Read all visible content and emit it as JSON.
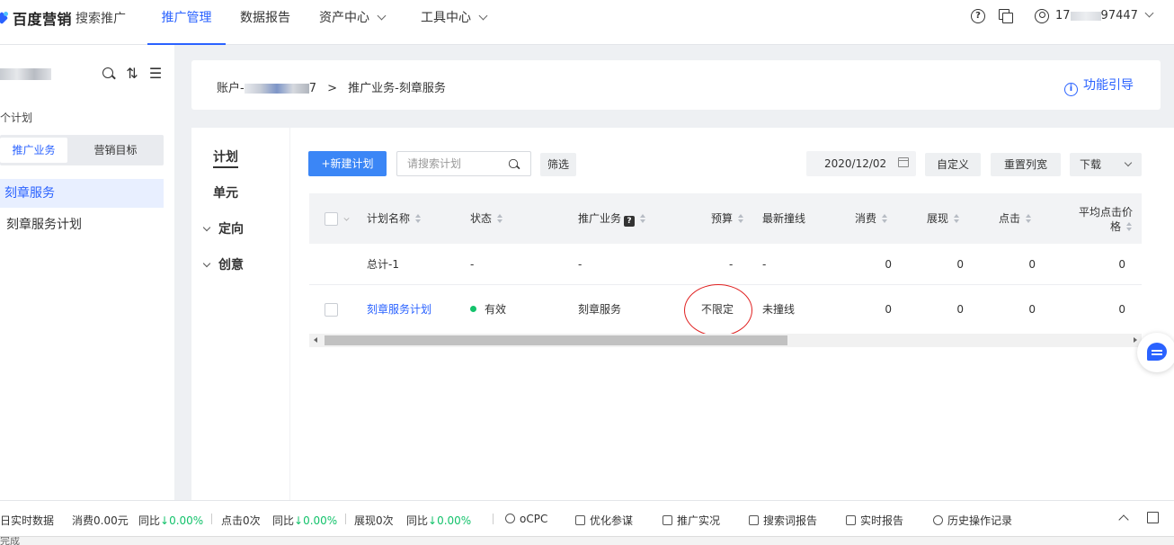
{
  "brand": {
    "name": "百度营销",
    "sub": "搜索推广"
  },
  "nav": [
    {
      "label": "推广管理",
      "active": true
    },
    {
      "label": "数据报告",
      "active": false
    },
    {
      "label": "资产中心",
      "active": false,
      "dropdown": true
    },
    {
      "label": "工具中心",
      "active": false,
      "dropdown": true
    }
  ],
  "header": {
    "account_prefix": "17",
    "account_suffix": "97447"
  },
  "sidebar": {
    "plan_count_label": "个计划",
    "tabs": [
      "推广业务",
      "营销目标"
    ],
    "items": [
      "刻章服务",
      "刻章服务计划"
    ]
  },
  "breadcrumb": {
    "account_label": "账户-",
    "account_tail": "7",
    "sep": ">",
    "path": "推广业务-刻章服务"
  },
  "guide_label": "功能引导",
  "subnav": {
    "items": [
      "计划",
      "单元",
      "定向",
      "创意"
    ]
  },
  "toolbar": {
    "new_plan": "+新建计划",
    "search_placeholder": "请搜索计划",
    "filter": "筛选",
    "date": "2020/12/02",
    "custom": "自定义",
    "reset_width": "重置列宽",
    "download": "下载"
  },
  "table": {
    "columns": [
      "计划名称",
      "状态",
      "推广业务",
      "预算",
      "最新撞线",
      "消费",
      "展现",
      "点击",
      "平均点击价格"
    ],
    "avg_click_price_line1": "平均点击价",
    "avg_click_price_line2": "格",
    "total_row": {
      "name": "总计-1",
      "status": "-",
      "business": "-",
      "budget": "-",
      "latest": "-",
      "cost": "0",
      "impressions": "0",
      "clicks": "0",
      "avg": "0"
    },
    "rows": [
      {
        "name": "刻章服务计划",
        "status": "有效",
        "business": "刻章服务",
        "budget": "不限定",
        "latest": "未撞线",
        "cost": "0",
        "impressions": "0",
        "clicks": "0",
        "avg": "0"
      }
    ]
  },
  "bottombar": {
    "realtime": "日实时数据",
    "cost": "消费0.00元",
    "yoy1": "同比",
    "yoy1_val": "↓0.00%",
    "clicks": "点击0次",
    "yoy2": "同比",
    "yoy2_val": "↓0.00%",
    "impressions": "展现0次",
    "yoy3": "同比",
    "yoy3_val": "↓0.00%",
    "ocpc": "oCPC",
    "optimize": "优化参谋",
    "promo_status": "推广实况",
    "search_report": "搜索词报告",
    "realtime_report": "实时报告",
    "history": "历史操作记录"
  },
  "statusbar": {
    "text": "完成"
  },
  "colors": {
    "accent": "#2a62ff",
    "primary_btn": "#3b86f6",
    "valid": "#13c26b",
    "annotation": "#e02020"
  }
}
